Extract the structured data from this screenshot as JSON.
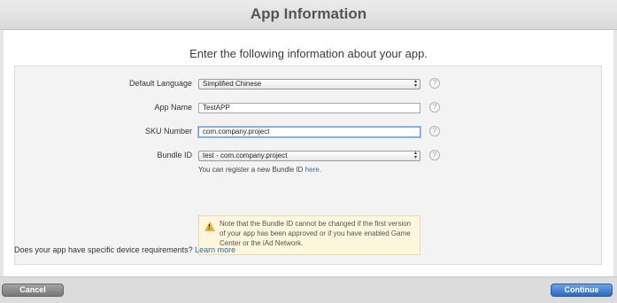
{
  "header": {
    "title": "App Information"
  },
  "intro": "Enter the following information about your app.",
  "form": {
    "default_language": {
      "label": "Default Language",
      "value": "Simplified Chinese"
    },
    "app_name": {
      "label": "App Name",
      "value": "TestAPP"
    },
    "sku_number": {
      "label": "SKU Number",
      "value": "com.company.project"
    },
    "bundle_id": {
      "label": "Bundle ID",
      "value": "test - com.company.project"
    },
    "bundle_note_prefix": "You can register a new Bundle ID ",
    "bundle_note_link": "here",
    "bundle_note_suffix": ".",
    "warning": "Note that the Bundle ID cannot be changed if the first version of your app has been approved or if you have enabled Game Center or the iAd Network.",
    "help_glyph": "?"
  },
  "device_question": "Does your app have specific device requirements?",
  "device_link": "Learn more",
  "footer": {
    "cancel": "Cancel",
    "continue": "Continue"
  },
  "icons": {
    "help": "help-icon",
    "warning": "warning-icon",
    "select": "chevron-updown-icon"
  },
  "colors": {
    "link": "#2e6db4",
    "continue": "#2c69c1",
    "warning_bg": "#fbf6dc"
  }
}
